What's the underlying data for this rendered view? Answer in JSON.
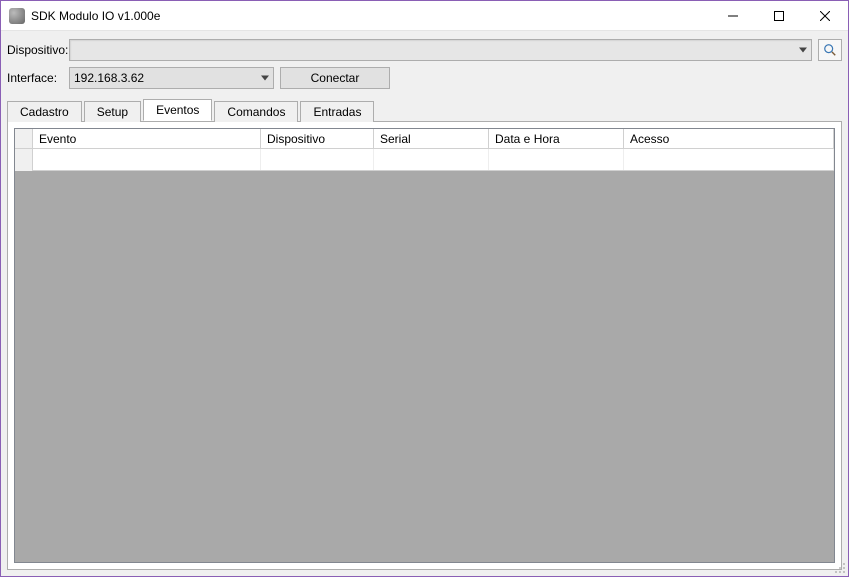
{
  "window": {
    "title": "SDK Modulo IO v1.000e"
  },
  "form": {
    "dispositivo_label": "Dispositivo:",
    "interface_label": "Interface:",
    "dispositivo_value": "",
    "interface_value": "192.168.3.62",
    "conectar_label": "Conectar"
  },
  "tabs": [
    {
      "label": "Cadastro"
    },
    {
      "label": "Setup"
    },
    {
      "label": "Eventos"
    },
    {
      "label": "Comandos"
    },
    {
      "label": "Entradas"
    }
  ],
  "grid": {
    "columns": [
      {
        "label": "Evento"
      },
      {
        "label": "Dispositivo"
      },
      {
        "label": "Serial"
      },
      {
        "label": "Data e Hora"
      },
      {
        "label": "Acesso"
      }
    ]
  }
}
